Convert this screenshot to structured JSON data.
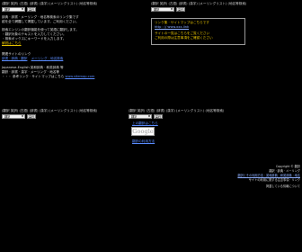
{
  "blocks": {
    "top_left": {
      "nav": "(翻訳 英訳)  (古語)  (辞書)  (漢字)  (メーリングリスト)  (地名等検索)",
      "select_value": "翻訳",
      "button_label": "実行",
      "intro_lines": [
        "辞典 · 辞書 · メーリング · 地名等検索のリンク集です",
        "越を全て網羅して掲載しています。ご利用ください。"
      ],
      "notice_lines": [
        "検索エンジンの翻訳機能を使って英語に翻訳します。",
        "・翻訳対象のテキストを入力してください。",
        "・検索ボックスにキーワードを入力します。",
        "メールの解説はこちら"
      ],
      "notice_link": "解説はこちら",
      "section2_title": "関連サイトのリンク",
      "section2_link1": "辞書 · 辞典 · 翻訳",
      "section2_link2": "メーリング · 地名検索",
      "section3_lines": [
        "Japanese-English 英和辞典 · 和英辞典 等",
        "翻訳 · 辞書 · 漢字 · メーリング · 地名等",
        "・・・ 参考リンク · サイトマップはこちら"
      ],
      "section3_link": "www.sitemap.com"
    },
    "top_right": {
      "nav": "(翻訳 英訳)  (古語)  (辞書)  (漢字)  (メーリングリスト)  (地名等検索)",
      "select_value": "翻訳",
      "button_label": "実行",
      "box_lines": [
        "リンク集 · サイトマップはこちらです",
        "http : // www.xxx-link",
        "サイトの一覧はこちらをご覧ください",
        "ご利用の際は注意事項をご確認ください"
      ]
    },
    "bottom_left": {
      "nav": "(翻訳 英訳)  (古語)  (辞書)  (漢字)  (メーリングリスト)  (地名等検索)",
      "select_value": "翻訳",
      "button_label": "実行"
    },
    "bottom_right": {
      "nav": "(翻訳 英訳)  (古語)  (辞書)  (漢字)  (メーリングリスト)  (地名等検索)",
      "select_value": "翻訳",
      "button_label": "実行",
      "links": [
        "上の翻訳はこちら",
        "翻訳の利用方法"
      ],
      "google_text": "Google"
    }
  },
  "footer": {
    "copyright": "Copyright © 翻訳",
    "lines": [
      "翻訳 · 辞典 · メーリング",
      "翻訳とその利用方法 · 英和辞典 · 和英辞典 · 地名",
      "サイトの利用に関する注意事項 · リンク",
      "掲載している情報について"
    ]
  }
}
